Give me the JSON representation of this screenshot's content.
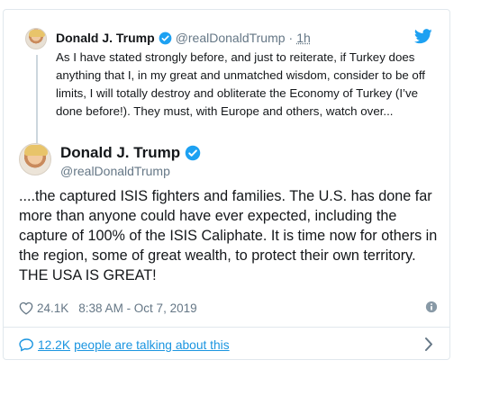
{
  "parent_tweet": {
    "name": "Donald J. Trump",
    "handle": "@realDonaldTrump",
    "separator": "·",
    "time": "1h",
    "text": "As I have stated strongly before, and just to reiterate, if Turkey does anything that I, in my great and unmatched wisdom, consider to be off limits, I will totally destroy and obliterate the Economy of Turkey (I’ve done before!). They must, with Europe and others, watch over..."
  },
  "main_tweet": {
    "name": "Donald J. Trump",
    "handle": "@realDonaldTrump",
    "text": "....the captured ISIS fighters and families. The U.S. has done far more than anyone could have ever expected, including the capture of 100% of the ISIS Caliphate. It is time now for others in the region, some of great wealth, to protect their own territory. THE USA IS GREAT!",
    "likes": "24.1K",
    "timestamp": "8:38 AM - Oct 7, 2019"
  },
  "footer": {
    "talk_count": "12.2K",
    "talk_text": "people are talking about this"
  },
  "colors": {
    "accent": "#1b95e0",
    "twitter_blue": "#1da1f2",
    "muted": "#657786",
    "border": "#e1e8ed"
  },
  "icons": {
    "brand": "twitter-bird-icon",
    "verified": "verified-badge-icon",
    "like": "heart-icon",
    "info": "info-icon",
    "conversation": "speech-bubble-icon",
    "expand": "chevron-right-icon"
  }
}
